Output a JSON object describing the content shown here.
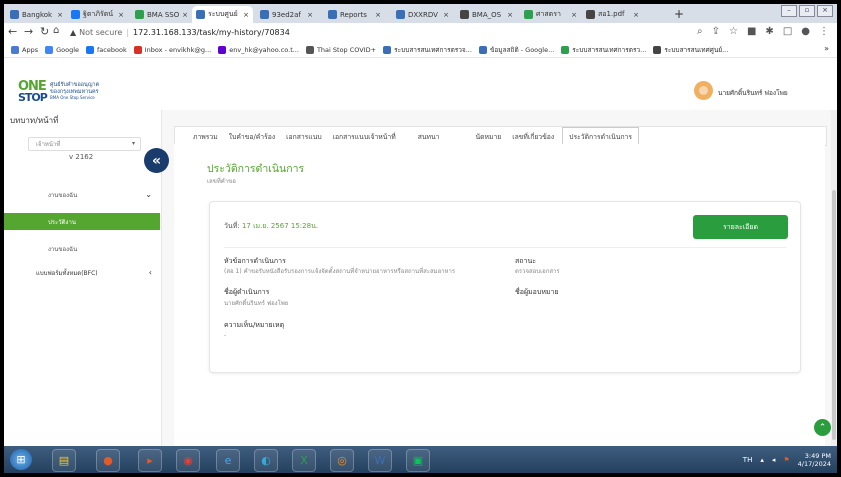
{
  "browser": {
    "tabs": [
      {
        "label": "Bangkok",
        "color": "#3b6fb5",
        "active": false
      },
      {
        "label": "ฐิตาภิรัตน์",
        "color": "#1877f2",
        "active": false
      },
      {
        "label": "BMA SSO",
        "color": "#2e9e4f",
        "active": false
      },
      {
        "label": "ระบบศูนย์",
        "color": "#3b6fb5",
        "active": true
      },
      {
        "label": "93ed2af",
        "color": "#3b6fb5",
        "active": false
      },
      {
        "label": "Reports",
        "color": "#3b6fb5",
        "active": false
      },
      {
        "label": "DXXRDV",
        "color": "#3b6fb5",
        "active": false
      },
      {
        "label": "BMA_OS",
        "color": "#444444",
        "active": false
      },
      {
        "label": "ศาสตรา",
        "color": "#2e9e4f",
        "active": false
      },
      {
        "label": "สอ1.pdf",
        "color": "#444444",
        "active": false
      }
    ],
    "address": {
      "security": "Not secure",
      "url": "172.31.168.133/task/my-history/70834"
    },
    "bookmarks": [
      {
        "label": "Apps",
        "color": "#4a7bd0"
      },
      {
        "label": "Google",
        "color": "#4285f4"
      },
      {
        "label": "facebook",
        "color": "#1877f2"
      },
      {
        "label": "Inbox - envikhk@g...",
        "color": "#d93025"
      },
      {
        "label": "env_hk@yahoo.co.t...",
        "color": "#6001d2"
      },
      {
        "label": "Thai Stop COVID+",
        "color": "#555555"
      },
      {
        "label": "ระบบสารสนเทศการตรวจ...",
        "color": "#3b6fb5"
      },
      {
        "label": "ข้อมูลสถิติ - Google...",
        "color": "#3b6fb5"
      },
      {
        "label": "ระบบสารสนเทศการตรว...",
        "color": "#2e9e4f"
      },
      {
        "label": "ระบบสารสนเทศศูนย์...",
        "color": "#444444"
      }
    ]
  },
  "app": {
    "logo_top": "ONE",
    "logo_bottom": "STOP",
    "logo_text_line1": "ศูนย์รับคำขออนุญาต",
    "logo_text_line2": "ของกรุงเทพมหานคร",
    "logo_text_line3": "BMA One Stop Service",
    "user_name": "นายศักดิ์นรินทร์ ฟองโพย"
  },
  "sidebar": {
    "title": "บทบาท/หน้าที่",
    "role_select": "เจ้าหน้าที่",
    "version": "v 2162",
    "items": [
      {
        "label": "งานของฉัน",
        "chevron": "⌄",
        "active": false
      },
      {
        "label": "ประวัติงาน",
        "chevron": "",
        "active": true
      },
      {
        "label": "งานของฉัน",
        "chevron": "",
        "active": false
      },
      {
        "label": "แบบฟอร์มทั้งหมด(BFC)",
        "chevron": "‹",
        "active": false
      }
    ]
  },
  "main": {
    "tabs": [
      {
        "label": "ภาพรวม",
        "active": false
      },
      {
        "label": "ใบคำขอ/คำร้อง",
        "active": false
      },
      {
        "label": "เอกสารแนบ",
        "active": false
      },
      {
        "label": "เอกสารแนบเจ้าหน้าที่",
        "active": false
      },
      {
        "label": "สนทนา",
        "active": false
      },
      {
        "label": "นัดหมาย",
        "active": false
      },
      {
        "label": "เลขที่เกี่ยวข้อง",
        "active": false
      },
      {
        "label": "ประวัติการดำเนินการ",
        "active": true
      }
    ],
    "page_title": "ประวัติการดำเนินการ",
    "page_subtitle": "เลขที่คำขอ",
    "record": {
      "date_label": "วันที่",
      "date_value": "17 เม.ย. 2567 15:28น.",
      "detail_button": "รายละเอียด",
      "topic_label": "หัวข้อการดำเนินการ",
      "topic_value": "(สอ 1) คำขอรับหนังสือรับรองการแจ้งจัดตั้งสถานที่จำหน่ายอาหารหรือสถานที่สะสมอาหาร",
      "status_label": "สถานะ",
      "status_value": "ตรวจสอบเอกสาร",
      "operator_label": "ชื่อผู้ดำเนินการ",
      "operator_value": "นายศักดิ์นรินทร์ ฟองโพย",
      "assignee_label": "ชื่อผู้มอบหมาย",
      "assignee_value": "",
      "comment_label": "ความเห็น/หมายเหตุ",
      "comment_value": "-"
    }
  },
  "taskbar": {
    "lang": "TH",
    "time": "3:49 PM",
    "date": "4/17/2024"
  }
}
